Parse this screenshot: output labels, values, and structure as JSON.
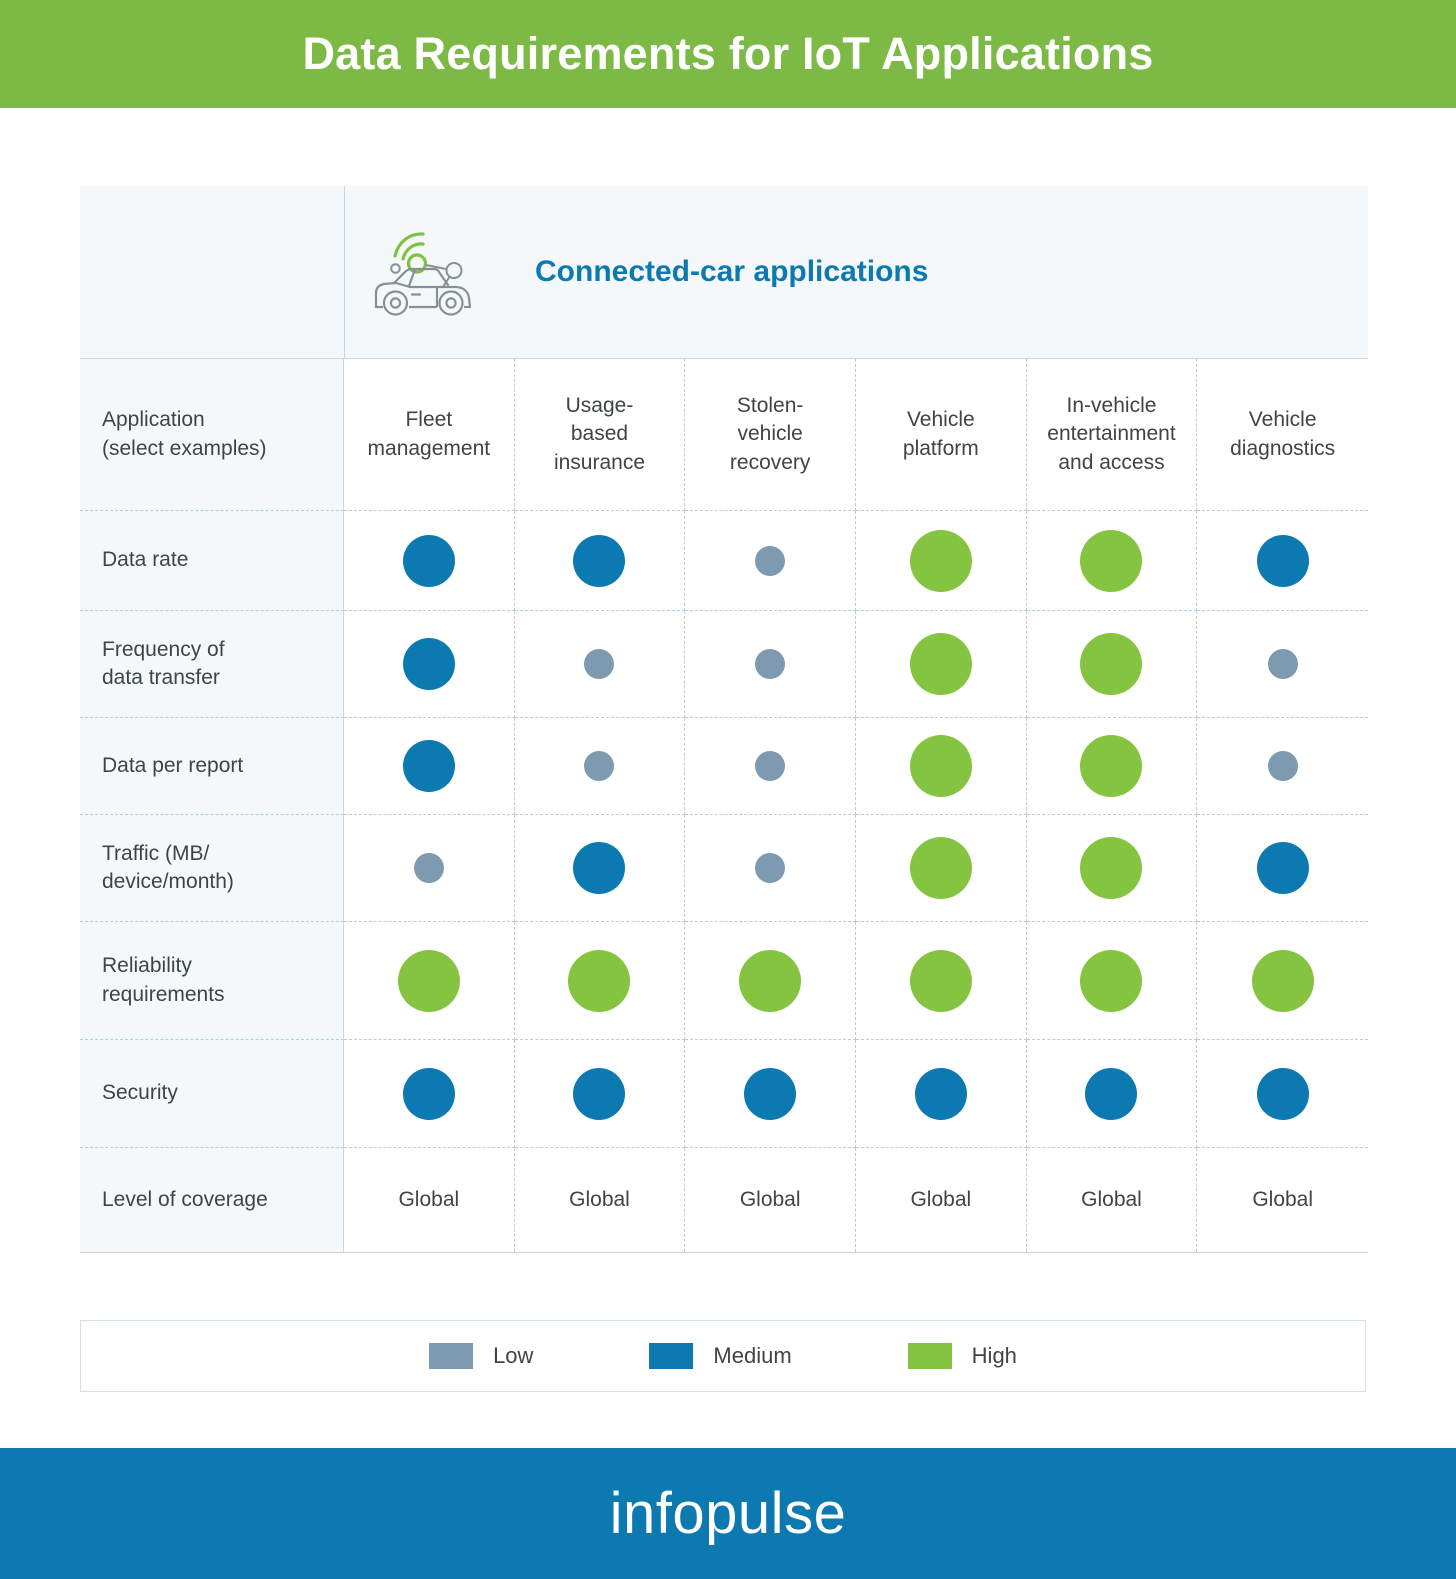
{
  "header": {
    "title": "Data Requirements for IoT Applications",
    "bar_color": "#7CB945"
  },
  "section": {
    "title": "Connected-car applications",
    "icon": "connected-car-icon",
    "title_color": "#0c7ab0"
  },
  "table": {
    "row_header_label": "Application\n(select examples)",
    "row_header_line1": "Application",
    "row_header_line2": "(select examples)",
    "columns": [
      {
        "label": "Fleet management",
        "line1": "Fleet",
        "line2": "management"
      },
      {
        "label": "Usage-based insurance",
        "line1": "Usage-",
        "line2": "based",
        "line3": "insurance"
      },
      {
        "label": "Stolen-vehicle recovery",
        "line1": "Stolen-",
        "line2": "vehicle",
        "line3": "recovery"
      },
      {
        "label": "Vehicle platform",
        "line1": "Vehicle",
        "line2": "platform"
      },
      {
        "label": "In-vehicle entertainment and access",
        "line1": "In-vehicle",
        "line2": "entertainment",
        "line3": "and access"
      },
      {
        "label": "Vehicle diagnostics",
        "line1": "Vehicle",
        "line2": "diagnostics"
      }
    ],
    "rows": [
      {
        "label": "Data rate",
        "line1": "Data rate",
        "type": "dots",
        "values": [
          "medium",
          "medium",
          "low",
          "high",
          "high",
          "medium"
        ]
      },
      {
        "label": "Frequency of data transfer",
        "line1": "Frequency of",
        "line2": "data transfer",
        "type": "dots",
        "values": [
          "medium",
          "low",
          "low",
          "high",
          "high",
          "low"
        ]
      },
      {
        "label": "Data per report",
        "line1": "Data per report",
        "type": "dots",
        "values": [
          "medium",
          "low",
          "low",
          "high",
          "high",
          "low"
        ]
      },
      {
        "label": "Traffic (MB/device/month)",
        "line1": "Traffic (MB/",
        "line2": "device/month)",
        "type": "dots",
        "values": [
          "low",
          "medium",
          "low",
          "high",
          "high",
          "medium"
        ]
      },
      {
        "label": "Reliability requirements",
        "line1": "Reliability",
        "line2": "requirements",
        "type": "dots",
        "values": [
          "high",
          "high",
          "high",
          "high",
          "high",
          "high"
        ]
      },
      {
        "label": "Security",
        "line1": "Security",
        "type": "dots",
        "values": [
          "medium",
          "medium",
          "medium",
          "medium",
          "medium",
          "medium"
        ]
      },
      {
        "label": "Level of coverage",
        "line1": "Level of coverage",
        "type": "text",
        "values": [
          "Global",
          "Global",
          "Global",
          "Global",
          "Global",
          "Global"
        ]
      }
    ]
  },
  "legend": {
    "items": [
      {
        "label": "Low",
        "color": "#7E9AB0"
      },
      {
        "label": "Medium",
        "color": "#0c7ab0"
      },
      {
        "label": "High",
        "color": "#85C440"
      }
    ]
  },
  "footer": {
    "brand": "infopulse",
    "bar_color": "#0c7ab0"
  },
  "chart_data": {
    "type": "heatmap",
    "title": "Data Requirements for IoT Applications",
    "subtitle": "Connected-car applications",
    "categories": [
      "Fleet management",
      "Usage-based insurance",
      "Stolen-vehicle recovery",
      "Vehicle platform",
      "In-vehicle entertainment and access",
      "Vehicle diagnostics"
    ],
    "row_labels": [
      "Data rate",
      "Frequency of data transfer",
      "Data per report",
      "Traffic (MB/device/month)",
      "Reliability requirements",
      "Security",
      "Level of coverage"
    ],
    "legend": [
      "Low",
      "Medium",
      "High"
    ],
    "legend_position": "bottom",
    "series": [
      {
        "name": "Data rate",
        "values": [
          "Medium",
          "Medium",
          "Low",
          "High",
          "High",
          "Medium"
        ]
      },
      {
        "name": "Frequency of data transfer",
        "values": [
          "Medium",
          "Low",
          "Low",
          "High",
          "High",
          "Low"
        ]
      },
      {
        "name": "Data per report",
        "values": [
          "Medium",
          "Low",
          "Low",
          "High",
          "High",
          "Low"
        ]
      },
      {
        "name": "Traffic (MB/device/month)",
        "values": [
          "Low",
          "Medium",
          "Low",
          "High",
          "High",
          "Medium"
        ]
      },
      {
        "name": "Reliability requirements",
        "values": [
          "High",
          "High",
          "High",
          "High",
          "High",
          "High"
        ]
      },
      {
        "name": "Security",
        "values": [
          "Medium",
          "Medium",
          "Medium",
          "Medium",
          "Medium",
          "Medium"
        ]
      },
      {
        "name": "Level of coverage",
        "values": [
          "Global",
          "Global",
          "Global",
          "Global",
          "Global",
          "Global"
        ]
      }
    ]
  }
}
